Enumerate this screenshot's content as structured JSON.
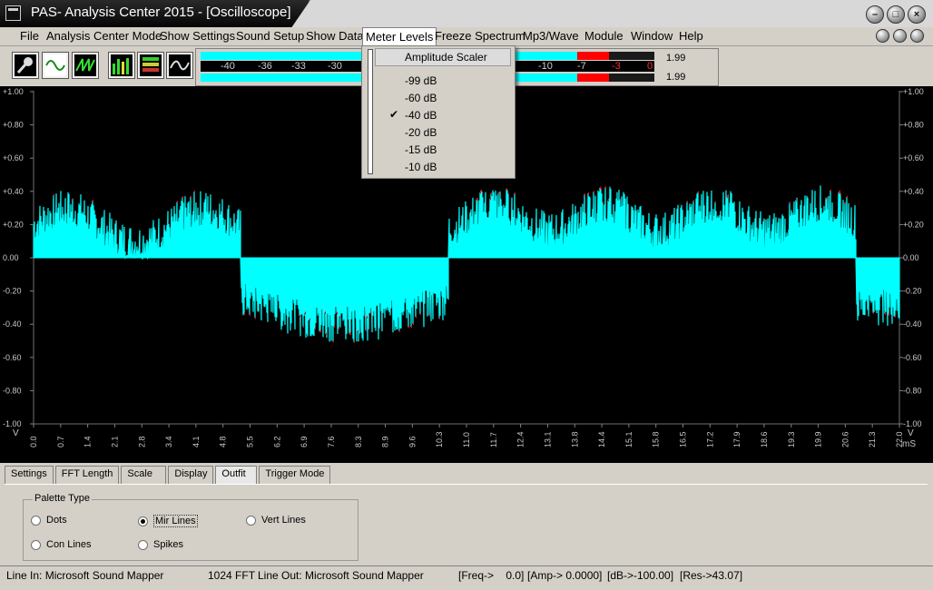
{
  "window": {
    "title": "PAS- Analysis Center 2015 - [Oscilloscope]",
    "buttons": {
      "minimize": "–",
      "maximize": "□",
      "close": "×"
    }
  },
  "menu": {
    "items": [
      "File",
      "Analysis Center Mode",
      "Show Settings",
      "Sound Setup",
      "Show Data",
      "Meter Levels",
      "Freeze Spectrum",
      "Mp3/Wave",
      "Module",
      "Window",
      "Help"
    ],
    "open_index": 5
  },
  "toolbar": {
    "tools": [
      "microphone-icon",
      "sine-wave-icon",
      "sawtooth-wave-icon",
      "spectrum-bars-icon",
      "data-display-icon",
      "waveform-scope-icon"
    ]
  },
  "meters": {
    "scale": [
      "-40",
      "-36",
      "-33",
      "-30",
      "-10",
      "-7",
      "-3",
      "0"
    ],
    "top_value": "1.99",
    "bottom_value": "1.99"
  },
  "meter_menu": {
    "header": "Amplitude Scaler",
    "items": [
      "-99 dB",
      "-60 dB",
      "-40 dB",
      "-20 dB",
      "-15 dB",
      "-10 dB"
    ],
    "checked_index": 2
  },
  "scope": {
    "y_ticks": [
      "+1.00",
      "+0.80",
      "+0.60",
      "+0.40",
      "+0.20",
      "0.00",
      "-0.20",
      "-0.40",
      "-0.60",
      "-0.80",
      "-1.00"
    ],
    "x_ticks": [
      "0.0",
      "0.7",
      "1.4",
      "2.1",
      "2.8",
      "3.4",
      "4.1",
      "4.8",
      "5.5",
      "6.2",
      "6.9",
      "7.6",
      "8.3",
      "8.9",
      "9.6",
      "10.3",
      "11.0",
      "11.7",
      "12.4",
      "13.1",
      "13.8",
      "14.4",
      "15.1",
      "15.8",
      "16.5",
      "17.2",
      "17.9",
      "18.6",
      "19.3",
      "19.9",
      "20.6",
      "21.3",
      "22.0"
    ],
    "y_unit": "V",
    "x_unit": "mS",
    "colors": {
      "wave": "#00ffff",
      "peaks": "#ff0000",
      "background": "#000000",
      "grid": "#808080"
    }
  },
  "tabs": {
    "items": [
      "Settings",
      "FFT Length",
      "Scale",
      "Display",
      "Outfit",
      "Trigger Mode"
    ],
    "active_index": 4
  },
  "palette": {
    "title": "Palette Type",
    "options": [
      "Dots",
      "Mir Lines",
      "Vert Lines",
      "Con Lines",
      "Spikes"
    ],
    "selected": "Mir Lines"
  },
  "status": {
    "line_in": "Line In: Microsoft Sound Mapper",
    "fft": "1024 FFT",
    "line_out": "Line Out: Microsoft Sound Mapper",
    "freq": "[Freq->    0.0]",
    "amp": "[Amp-> 0.0000]",
    "db": "[dB->-100.00]",
    "res": "[Res->43.07]"
  }
}
